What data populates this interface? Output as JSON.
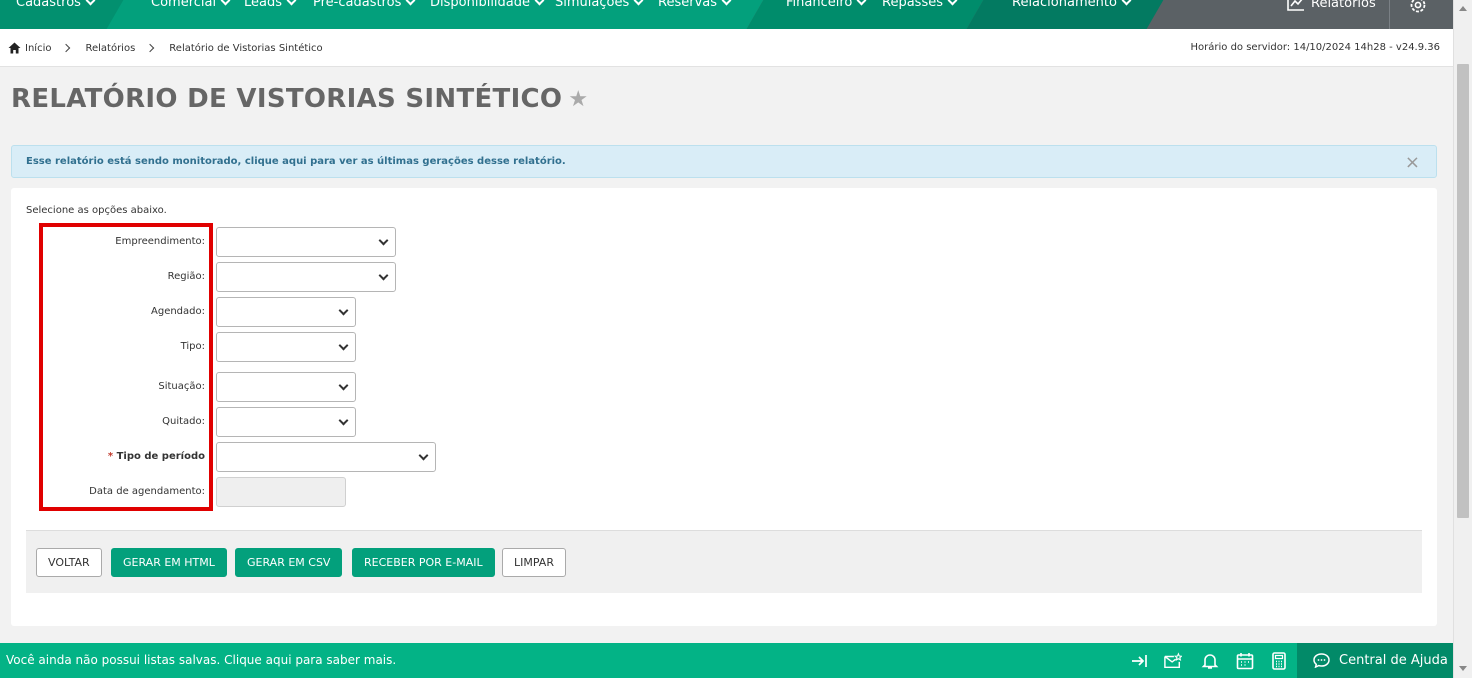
{
  "nav": {
    "items": [
      {
        "label": "Cadastros"
      },
      {
        "label": "Comercial"
      },
      {
        "label": "Leads"
      },
      {
        "label": "Pré-cadastros"
      },
      {
        "label": "Disponibilidade"
      },
      {
        "label": "Simulações"
      },
      {
        "label": "Reservas"
      },
      {
        "label": "Financeiro"
      },
      {
        "label": "Repasses"
      },
      {
        "label": "Relacionamento"
      }
    ],
    "reports_label": "Relatórios",
    "settings_icon": "gear-icon"
  },
  "breadcrumb": {
    "home": "Início",
    "level1": "Relatórios",
    "current": "Relatório de Vistorias Sintético"
  },
  "server_time": "Horário do servidor: 14/10/2024 14h28 - v24.9.36",
  "page_title": "RELATÓRIO DE VISTORIAS SINTÉTICO",
  "alert": {
    "text": "Esse relatório está sendo monitorado, clique aqui para ver as últimas gerações desse relatório.",
    "close": "×"
  },
  "form": {
    "intro": "Selecione as opções abaixo.",
    "fields": [
      {
        "label": "Empreendimento:",
        "value": ""
      },
      {
        "label": "Região:",
        "value": ""
      },
      {
        "label": "Agendado:",
        "value": ""
      },
      {
        "label": "Tipo:",
        "value": ""
      },
      {
        "label": "Situação:",
        "value": ""
      },
      {
        "label": "Quitado:",
        "value": ""
      },
      {
        "label": "Tipo de período",
        "required_mark": "*",
        "value": ""
      },
      {
        "label": "Data de agendamento:",
        "value": ""
      }
    ]
  },
  "actions": {
    "back": "VOLTAR",
    "html": "GERAR EM HTML",
    "csv": "GERAR EM CSV",
    "email": "RECEBER POR E-MAIL",
    "clear": "LIMPAR"
  },
  "footer": {
    "text": "Você ainda não possui listas salvas. Clique aqui para saber mais.",
    "help": "Central de Ajuda"
  },
  "colors": {
    "brand": "#03a07c",
    "footer": "#03b386",
    "highlight": "#e00000"
  }
}
